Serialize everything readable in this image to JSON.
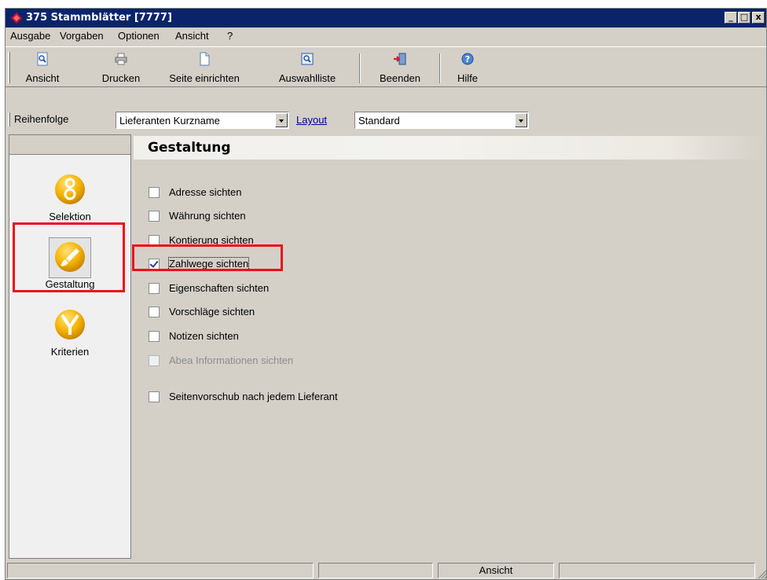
{
  "window": {
    "title": "375 Stammblätter [7777]",
    "buttons": {
      "minimize": "_",
      "maximize": "□",
      "close": "x"
    }
  },
  "menu": [
    {
      "label": "Ausgabe"
    },
    {
      "label": "Vorgaben"
    },
    {
      "label": "Optionen"
    },
    {
      "label": "Ansicht"
    },
    {
      "label": "?"
    }
  ],
  "toolbar": [
    {
      "label": "Ansicht",
      "icon": "preview-icon"
    },
    {
      "label": "Drucken",
      "icon": "printer-icon"
    },
    {
      "label": "Seite einrichten",
      "icon": "page-setup-icon"
    },
    {
      "label": "Auswahlliste",
      "icon": "selection-list-icon"
    },
    {
      "label": "Beenden",
      "icon": "exit-icon"
    },
    {
      "label": "Hilfe",
      "icon": "help-icon"
    }
  ],
  "options_bar": {
    "sort_label": "Reihenfolge",
    "sort_value": "Lieferanten Kurzname",
    "layout_link": "Layout",
    "layout_value": "Standard"
  },
  "sidebar": {
    "items": [
      {
        "label": "Selektion",
        "icon": "selection-icon",
        "active": false
      },
      {
        "label": "Gestaltung",
        "icon": "brush-icon",
        "active": true
      },
      {
        "label": "Kriterien",
        "icon": "filter-icon",
        "active": false
      }
    ]
  },
  "panel": {
    "title": "Gestaltung",
    "options": [
      {
        "label": "Adresse sichten",
        "checked": false,
        "enabled": true
      },
      {
        "label": "Währung sichten",
        "checked": false,
        "enabled": true
      },
      {
        "label": "Kontierung sichten",
        "checked": false,
        "enabled": true
      },
      {
        "label": "Zahlwege sichten",
        "checked": true,
        "enabled": true
      },
      {
        "label": "Eigenschaften sichten",
        "checked": false,
        "enabled": true
      },
      {
        "label": "Vorschläge sichten",
        "checked": false,
        "enabled": true
      },
      {
        "label": "Notizen sichten",
        "checked": false,
        "enabled": true
      },
      {
        "label": "Abea Informationen sichten",
        "checked": false,
        "enabled": false
      },
      {
        "label": "Seitenvorschub nach jedem Lieferant",
        "checked": false,
        "enabled": true
      }
    ]
  },
  "statusbar": {
    "panels": [
      "",
      "",
      "Ansicht",
      ""
    ]
  },
  "colors": {
    "titlebar": "#0a246a",
    "window_bg": "#d4d0c8",
    "highlight_box": "#e8121a",
    "link": "#00009c",
    "orb_yellow": "#f4b400"
  }
}
